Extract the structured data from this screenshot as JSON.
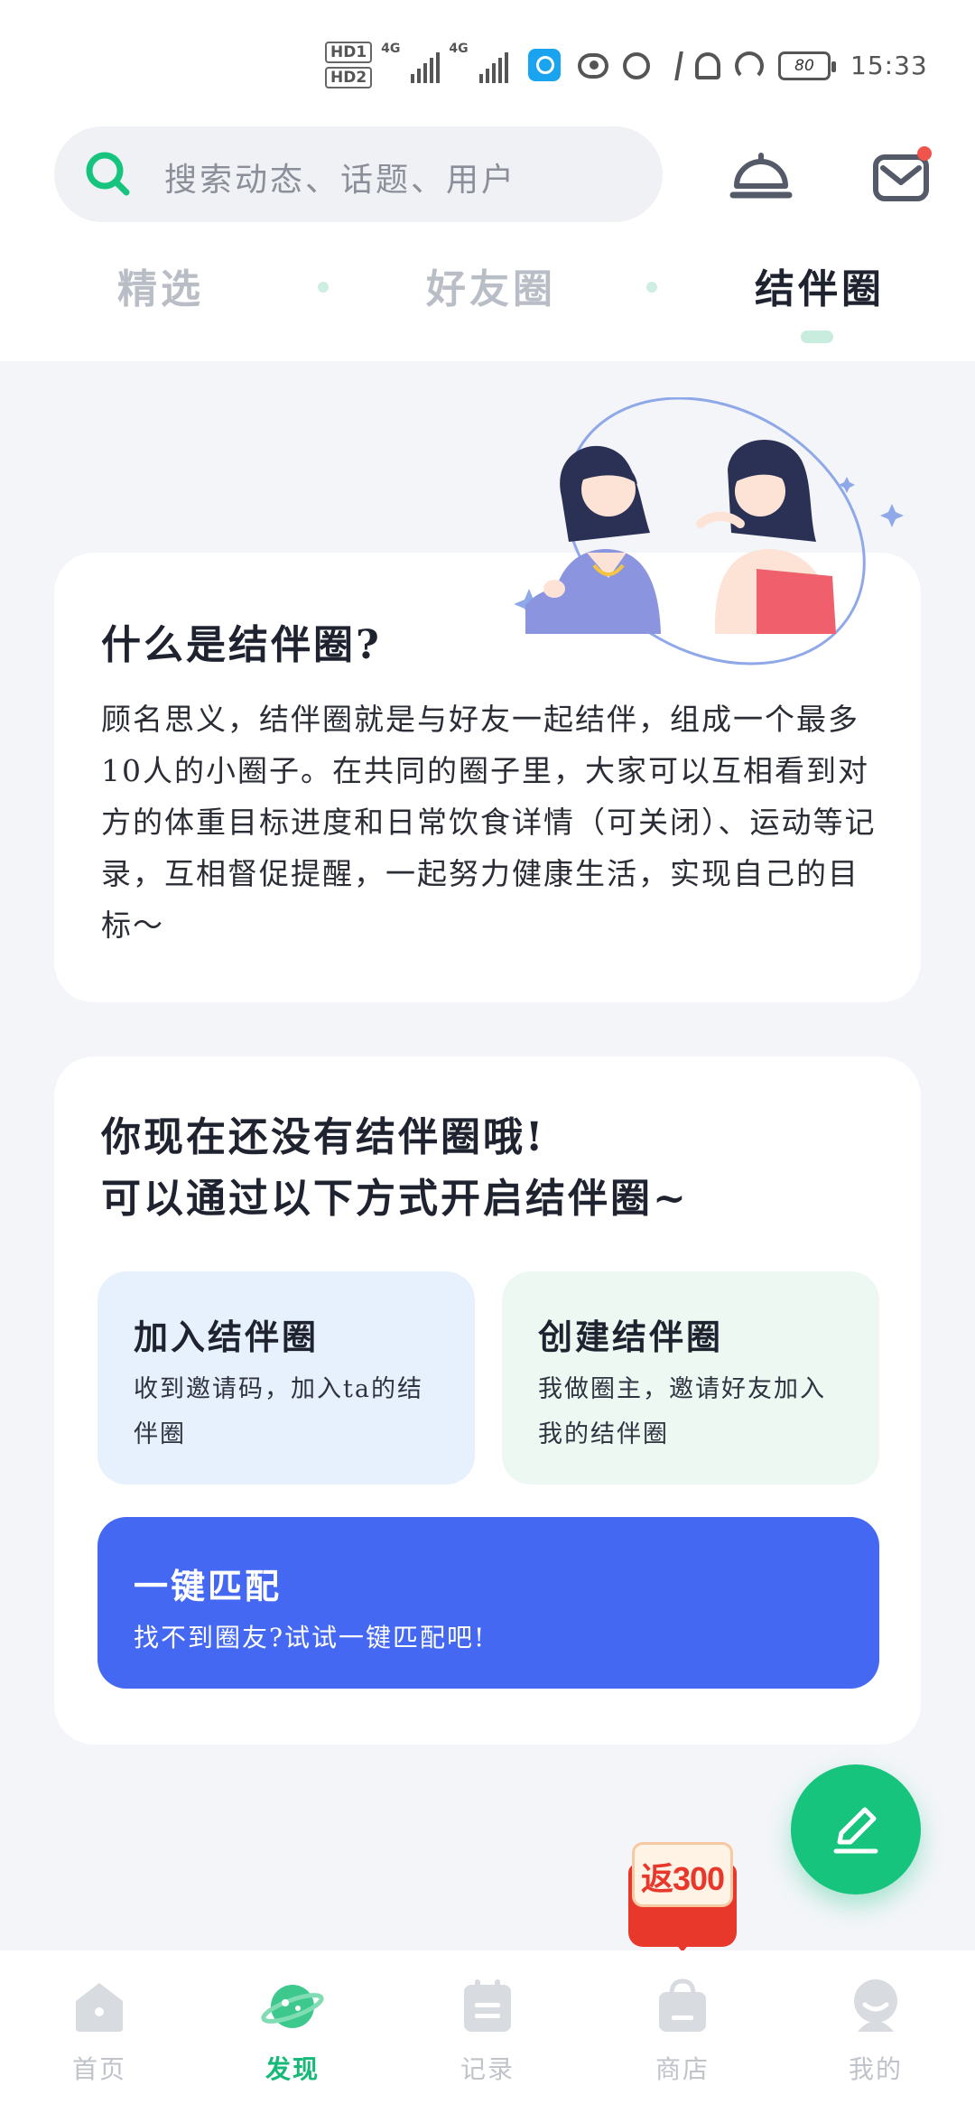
{
  "status_bar": {
    "hd1": "HD1",
    "hd2": "HD2",
    "net1": "4G",
    "net2": "4G",
    "battery": "80",
    "time": "15:33"
  },
  "header": {
    "search_placeholder": "搜索动态、话题、用户",
    "tabs": [
      {
        "label": "精选",
        "active": false
      },
      {
        "label": "好友圈",
        "active": false
      },
      {
        "label": "结伴圈",
        "active": true
      }
    ]
  },
  "intro_card": {
    "title": "什么是结伴圈?",
    "body": "顾名思义，结伴圈就是与好友一起结伴，组成一个最多10人的小圈子。在共同的圈子里，大家可以互相看到对方的体重目标进度和日常饮食详情（可关闭）、运动等记录，互相督促提醒，一起努力健康生活，实现自己的目标～"
  },
  "empty_card": {
    "title_line1": "你现在还没有结伴圈哦!",
    "title_line2": "可以通过以下方式开启结伴圈~",
    "join": {
      "title": "加入结伴圈",
      "desc": "收到邀请码，加入ta的结伴圈"
    },
    "create": {
      "title": "创建结伴圈",
      "desc": "我做圈主，邀请好友加入我的结伴圈"
    },
    "match": {
      "title": "一键匹配",
      "desc": "找不到圈友?试试一键匹配吧!"
    }
  },
  "promo": {
    "label": "返300"
  },
  "bottom_nav": [
    {
      "label": "首页",
      "icon": "home-icon",
      "active": false
    },
    {
      "label": "发现",
      "icon": "planet-icon",
      "active": true
    },
    {
      "label": "记录",
      "icon": "calendar-icon",
      "active": false
    },
    {
      "label": "商店",
      "icon": "shop-bag-icon",
      "active": false
    },
    {
      "label": "我的",
      "icon": "profile-icon",
      "active": false
    }
  ],
  "colors": {
    "accent_green": "#17c47e",
    "match_blue": "#4568f2",
    "join_bg": "#e7f1fd",
    "create_bg": "#ecf8f1",
    "page_bg": "#f3f5f9"
  }
}
